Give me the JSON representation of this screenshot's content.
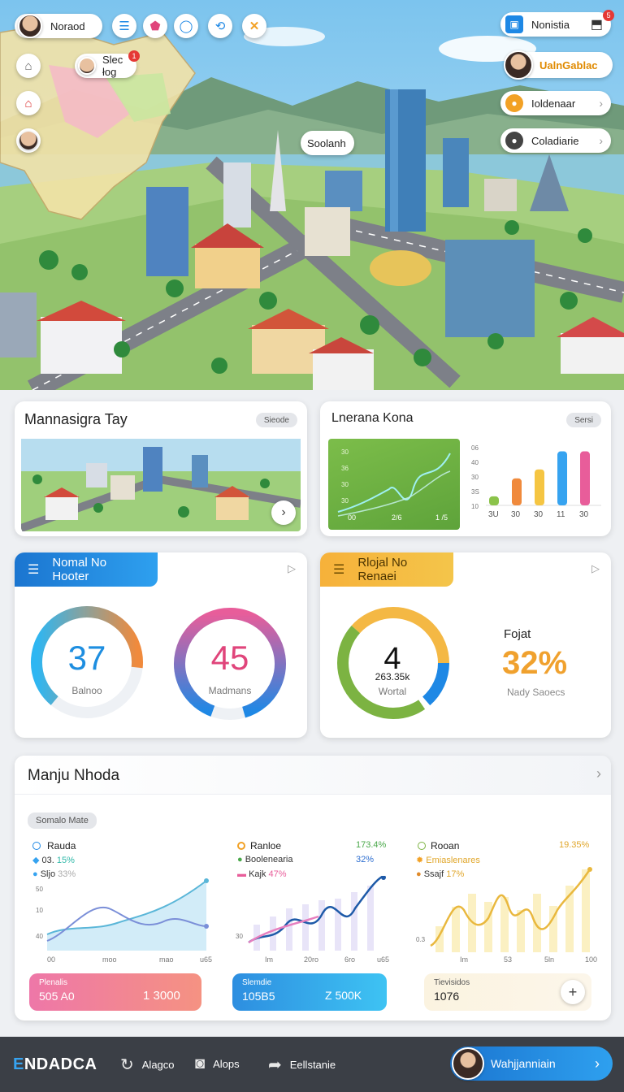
{
  "hero": {
    "user_chip": "Noraod",
    "slet_chip": "Slec łog",
    "slet_badge": "1",
    "center_label": "Soolanh",
    "top_right_chip": "Nonistia",
    "top_right_badge": "5",
    "profile_chip": "UalnGablac",
    "right_chip_1": "Ioldenaar",
    "right_chip_2": "Coladiarie"
  },
  "card_map": {
    "title": "Mannasigra Tay",
    "pill": "Sieode"
  },
  "card_line": {
    "title": "Lnerana Kona",
    "pill": "Sersi",
    "line_y_ticks": [
      "30",
      "36",
      "30",
      "30"
    ],
    "line_x_ticks": [
      "00",
      "2/6",
      "1 /5"
    ],
    "bar_y_ticks": [
      "06",
      "40",
      "30",
      "3S",
      "10"
    ],
    "bar_x_ticks": [
      "3U",
      "30",
      "30",
      "11",
      "30"
    ]
  },
  "chart_data": [
    {
      "type": "bar",
      "categories": [
        "3U",
        "30",
        "30",
        "11",
        "30"
      ],
      "values": [
        1,
        3,
        4,
        6,
        6
      ],
      "colors": [
        "#8bc34a",
        "#f08a3c",
        "#f5c542",
        "#36a3f0",
        "#e85d9a"
      ]
    }
  ],
  "gauge_card_1": {
    "tag": "Nomal No Hooter",
    "g1_value": "37",
    "g1_label": "Balnoo",
    "g1_fraction": 0.7,
    "g2_value": "45",
    "g2_label": "Madmans",
    "g2_fraction": 0.9
  },
  "gauge_card_2": {
    "tag": "Rlojal No Renaei",
    "g_value": "4",
    "g_sub": "263.35k",
    "g_label": "Wortal",
    "side_title": "Fojat",
    "side_value": "32%",
    "side_label": "Nady Saoecs"
  },
  "panel": {
    "title": "Manju Nhoda",
    "pill": "Somalo Mate",
    "col1": {
      "title": "Rauda",
      "row1_label": "03. ",
      "row1_value": "15%",
      "row2_label": "Sljo ",
      "row2_value": "33%",
      "y_ticks": [
        "50",
        "10",
        "40"
      ],
      "x_ticks": [
        "00",
        "moo",
        "mao",
        "u65"
      ]
    },
    "col2": {
      "title": "Ranloe",
      "value_a": "173.4%",
      "row1_label": "Boolenearia",
      "row1_value": "32%",
      "row2_label": "Kajk ",
      "row2_value": "47%",
      "y_ticks": [
        "30"
      ],
      "x_ticks": [
        "Im",
        "20ro",
        "6ro",
        "u65"
      ]
    },
    "col3": {
      "title": "Rooan",
      "value_a": "19.35%",
      "row1_label": "Emiaslenares",
      "row2_label": "Ssajf ",
      "row2_value": "17%",
      "y_ticks": [
        "0.3"
      ],
      "x_ticks": [
        "Im",
        "53",
        "5ln",
        "100"
      ]
    },
    "stat1_label": "Plenalis",
    "stat1_value": "505 A0",
    "stat1_extra": "1 3000",
    "stat2_label": "Slemdie",
    "stat2_value": "105B5",
    "stat2_extra": "Z 500K",
    "stat3_label": "Tievisidos",
    "stat3_value": "1076"
  },
  "bottom": {
    "brand": "NDADCA",
    "nav1": "Alagco",
    "nav2": "Alops",
    "nav3": "Eellstanie",
    "cta": "Wahjjanniain"
  }
}
